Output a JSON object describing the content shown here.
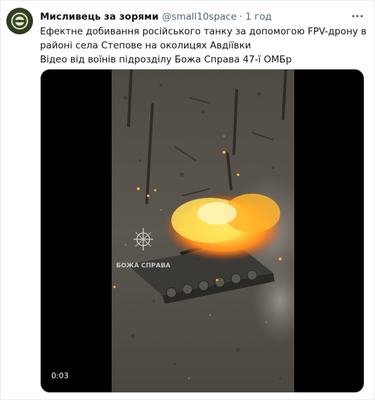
{
  "tweet": {
    "display_name": "Мисливець за зорями",
    "handle": "@small10space",
    "separator": "·",
    "time": "1 год",
    "text_lines": [
      "Ефектне добивання російського танку за допомогою FPV-дрону в",
      "районі села Степове на околицях Авдіївки",
      "Відео від воїнів підрозділу Божа Справа 47-ї ОМБр"
    ],
    "more_icon": "more-horizontal-icon"
  },
  "media": {
    "duration": "0:03",
    "watermark": "БОЖА СПРАВА",
    "colors": {
      "fire": "#ff9a1f",
      "ground": "#5f5a52",
      "background": "#000000"
    }
  }
}
